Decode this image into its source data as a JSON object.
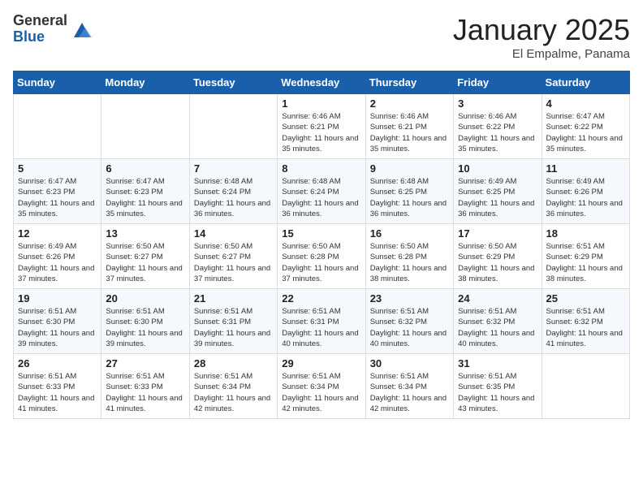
{
  "header": {
    "logo_general": "General",
    "logo_blue": "Blue",
    "month_title": "January 2025",
    "location": "El Empalme, Panama"
  },
  "days_of_week": [
    "Sunday",
    "Monday",
    "Tuesday",
    "Wednesday",
    "Thursday",
    "Friday",
    "Saturday"
  ],
  "weeks": [
    [
      {
        "day": "",
        "info": ""
      },
      {
        "day": "",
        "info": ""
      },
      {
        "day": "",
        "info": ""
      },
      {
        "day": "1",
        "info": "Sunrise: 6:46 AM\nSunset: 6:21 PM\nDaylight: 11 hours and 35 minutes."
      },
      {
        "day": "2",
        "info": "Sunrise: 6:46 AM\nSunset: 6:21 PM\nDaylight: 11 hours and 35 minutes."
      },
      {
        "day": "3",
        "info": "Sunrise: 6:46 AM\nSunset: 6:22 PM\nDaylight: 11 hours and 35 minutes."
      },
      {
        "day": "4",
        "info": "Sunrise: 6:47 AM\nSunset: 6:22 PM\nDaylight: 11 hours and 35 minutes."
      }
    ],
    [
      {
        "day": "5",
        "info": "Sunrise: 6:47 AM\nSunset: 6:23 PM\nDaylight: 11 hours and 35 minutes."
      },
      {
        "day": "6",
        "info": "Sunrise: 6:47 AM\nSunset: 6:23 PM\nDaylight: 11 hours and 35 minutes."
      },
      {
        "day": "7",
        "info": "Sunrise: 6:48 AM\nSunset: 6:24 PM\nDaylight: 11 hours and 36 minutes."
      },
      {
        "day": "8",
        "info": "Sunrise: 6:48 AM\nSunset: 6:24 PM\nDaylight: 11 hours and 36 minutes."
      },
      {
        "day": "9",
        "info": "Sunrise: 6:48 AM\nSunset: 6:25 PM\nDaylight: 11 hours and 36 minutes."
      },
      {
        "day": "10",
        "info": "Sunrise: 6:49 AM\nSunset: 6:25 PM\nDaylight: 11 hours and 36 minutes."
      },
      {
        "day": "11",
        "info": "Sunrise: 6:49 AM\nSunset: 6:26 PM\nDaylight: 11 hours and 36 minutes."
      }
    ],
    [
      {
        "day": "12",
        "info": "Sunrise: 6:49 AM\nSunset: 6:26 PM\nDaylight: 11 hours and 37 minutes."
      },
      {
        "day": "13",
        "info": "Sunrise: 6:50 AM\nSunset: 6:27 PM\nDaylight: 11 hours and 37 minutes."
      },
      {
        "day": "14",
        "info": "Sunrise: 6:50 AM\nSunset: 6:27 PM\nDaylight: 11 hours and 37 minutes."
      },
      {
        "day": "15",
        "info": "Sunrise: 6:50 AM\nSunset: 6:28 PM\nDaylight: 11 hours and 37 minutes."
      },
      {
        "day": "16",
        "info": "Sunrise: 6:50 AM\nSunset: 6:28 PM\nDaylight: 11 hours and 38 minutes."
      },
      {
        "day": "17",
        "info": "Sunrise: 6:50 AM\nSunset: 6:29 PM\nDaylight: 11 hours and 38 minutes."
      },
      {
        "day": "18",
        "info": "Sunrise: 6:51 AM\nSunset: 6:29 PM\nDaylight: 11 hours and 38 minutes."
      }
    ],
    [
      {
        "day": "19",
        "info": "Sunrise: 6:51 AM\nSunset: 6:30 PM\nDaylight: 11 hours and 39 minutes."
      },
      {
        "day": "20",
        "info": "Sunrise: 6:51 AM\nSunset: 6:30 PM\nDaylight: 11 hours and 39 minutes."
      },
      {
        "day": "21",
        "info": "Sunrise: 6:51 AM\nSunset: 6:31 PM\nDaylight: 11 hours and 39 minutes."
      },
      {
        "day": "22",
        "info": "Sunrise: 6:51 AM\nSunset: 6:31 PM\nDaylight: 11 hours and 40 minutes."
      },
      {
        "day": "23",
        "info": "Sunrise: 6:51 AM\nSunset: 6:32 PM\nDaylight: 11 hours and 40 minutes."
      },
      {
        "day": "24",
        "info": "Sunrise: 6:51 AM\nSunset: 6:32 PM\nDaylight: 11 hours and 40 minutes."
      },
      {
        "day": "25",
        "info": "Sunrise: 6:51 AM\nSunset: 6:32 PM\nDaylight: 11 hours and 41 minutes."
      }
    ],
    [
      {
        "day": "26",
        "info": "Sunrise: 6:51 AM\nSunset: 6:33 PM\nDaylight: 11 hours and 41 minutes."
      },
      {
        "day": "27",
        "info": "Sunrise: 6:51 AM\nSunset: 6:33 PM\nDaylight: 11 hours and 41 minutes."
      },
      {
        "day": "28",
        "info": "Sunrise: 6:51 AM\nSunset: 6:34 PM\nDaylight: 11 hours and 42 minutes."
      },
      {
        "day": "29",
        "info": "Sunrise: 6:51 AM\nSunset: 6:34 PM\nDaylight: 11 hours and 42 minutes."
      },
      {
        "day": "30",
        "info": "Sunrise: 6:51 AM\nSunset: 6:34 PM\nDaylight: 11 hours and 42 minutes."
      },
      {
        "day": "31",
        "info": "Sunrise: 6:51 AM\nSunset: 6:35 PM\nDaylight: 11 hours and 43 minutes."
      },
      {
        "day": "",
        "info": ""
      }
    ]
  ]
}
